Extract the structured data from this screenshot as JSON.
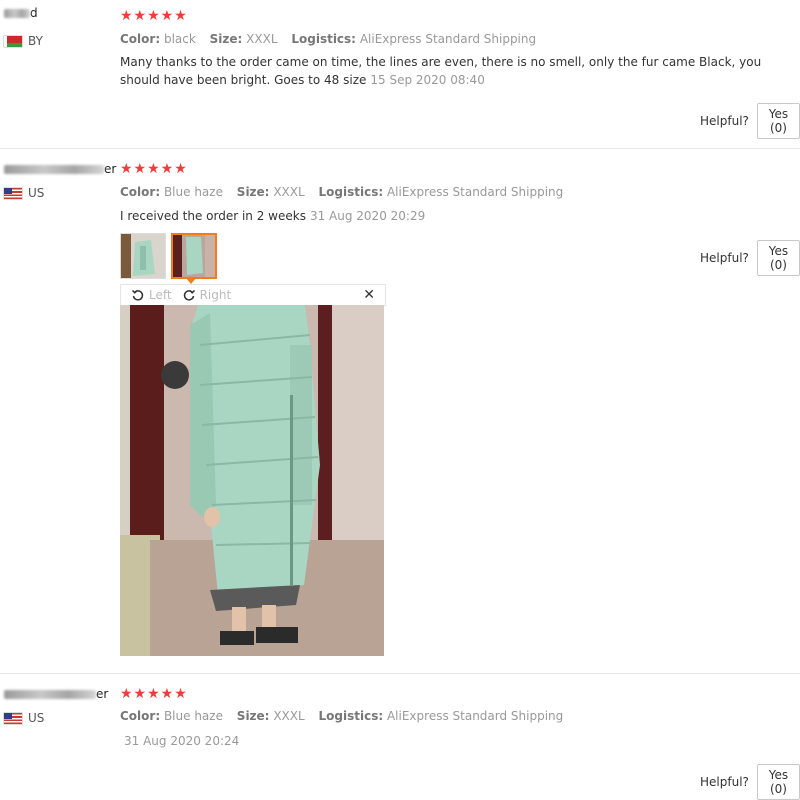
{
  "reviews": [
    {
      "user_suffix": "d",
      "country": "BY",
      "stars": "★★★★★",
      "color_label": "Color:",
      "color_value": "black",
      "size_label": "Size:",
      "size_value": "XXXL",
      "logistics_label": "Logistics:",
      "logistics_value": "AliExpress Standard Shipping",
      "text": "Many thanks to the order came on time, the lines are even, there is no smell, only the fur came Black, you should have been bright. Goes to 48 size",
      "date": "15 Sep 2020 08:40",
      "helpful_label": "Helpful?",
      "yes_label": "Yes (0)"
    },
    {
      "user_suffix": "er",
      "country": "US",
      "stars": "★★★★★",
      "color_label": "Color:",
      "color_value": "Blue haze",
      "size_label": "Size:",
      "size_value": "XXXL",
      "logistics_label": "Logistics:",
      "logistics_value": "AliExpress Standard Shipping",
      "text": "I received the order in 2 weeks",
      "date": "31 Aug 2020 20:29",
      "helpful_label": "Helpful?",
      "yes_label": "Yes (0)",
      "viewer": {
        "rotate_left_label": "Left",
        "rotate_right_label": "Right",
        "close_glyph": "✕"
      }
    },
    {
      "user_suffix": "er",
      "country": "US",
      "stars": "★★★★★",
      "color_label": "Color:",
      "color_value": "Blue haze",
      "size_label": "Size:",
      "size_value": "XXXL",
      "logistics_label": "Logistics:",
      "logistics_value": "AliExpress Standard Shipping",
      "text": "",
      "date": "31 Aug 2020 20:24",
      "helpful_label": "Helpful?",
      "yes_label": "Yes (0)"
    }
  ],
  "colors": {
    "star": "#f23c3c",
    "active_thumb_border": "#f07c1b",
    "coat": "#a9d6c2",
    "separator": "#e8e8e8"
  }
}
